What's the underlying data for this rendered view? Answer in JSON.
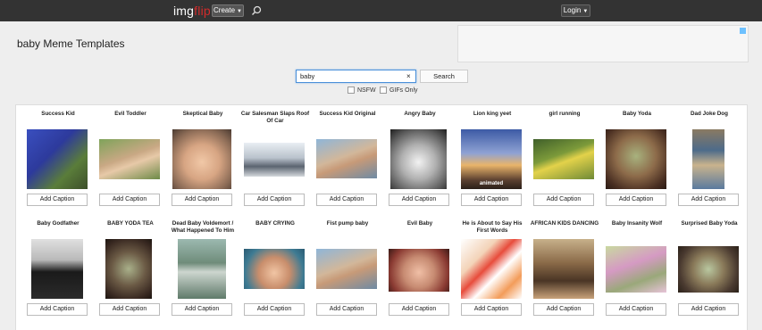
{
  "topbar": {
    "logo_img": "img",
    "logo_flip": "flip",
    "create_label": "Create",
    "login_label": "Login"
  },
  "page_title": "baby Meme Templates",
  "search": {
    "value": "baby",
    "clear": "×",
    "button_label": "Search"
  },
  "filters": {
    "nsfw": "NSFW",
    "gifs": "GIFs Only"
  },
  "caption_label": "Add Caption",
  "templates": [
    {
      "title": "Success Kid"
    },
    {
      "title": "Evil Toddler"
    },
    {
      "title": "Skeptical Baby"
    },
    {
      "title": "Car Salesman Slaps Roof Of Car"
    },
    {
      "title": "Success Kid Original"
    },
    {
      "title": "Angry Baby"
    },
    {
      "title": "Lion king yeet",
      "badge": "animated"
    },
    {
      "title": "girl running"
    },
    {
      "title": "Baby Yoda"
    },
    {
      "title": "Dad Joke Dog"
    },
    {
      "title": "Baby Godfather"
    },
    {
      "title": "BABY YODA TEA"
    },
    {
      "title": "Dead Baby Voldemort / What Happened To Him"
    },
    {
      "title": "BABY CRYING"
    },
    {
      "title": "Fist pump baby"
    },
    {
      "title": "Evil Baby"
    },
    {
      "title": "He is About to Say His First Words"
    },
    {
      "title": "AFRICAN KIDS DANCING"
    },
    {
      "title": "Baby Insanity Wolf"
    },
    {
      "title": "Surprised Baby Yoda"
    }
  ]
}
